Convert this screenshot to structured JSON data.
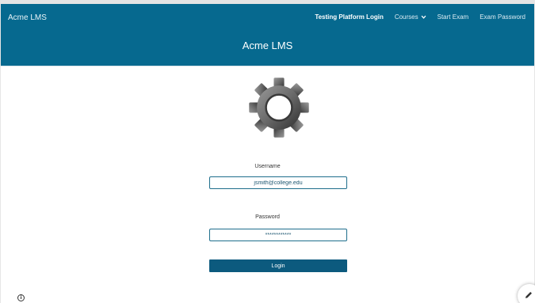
{
  "header": {
    "brand": "Acme LMS",
    "nav": {
      "testing_login": "Testing Platform Login",
      "courses": "Courses",
      "start_exam": "Start Exam",
      "exam_password": "Exam Password"
    }
  },
  "banner": {
    "title": "Acme LMS"
  },
  "logo": {
    "icon": "gear-icon"
  },
  "form": {
    "username_label": "Username",
    "username_value": "jsmith@college.edu",
    "password_label": "Password",
    "password_value": "************",
    "login_label": "Login"
  },
  "footer": {
    "info_icon": "info-icon",
    "info_glyph": "i",
    "edit_icon": "pencil-icon"
  },
  "colors": {
    "header_bg": "#06698f",
    "button_bg": "#0c5a7e",
    "field_border": "#1e6e8c"
  }
}
